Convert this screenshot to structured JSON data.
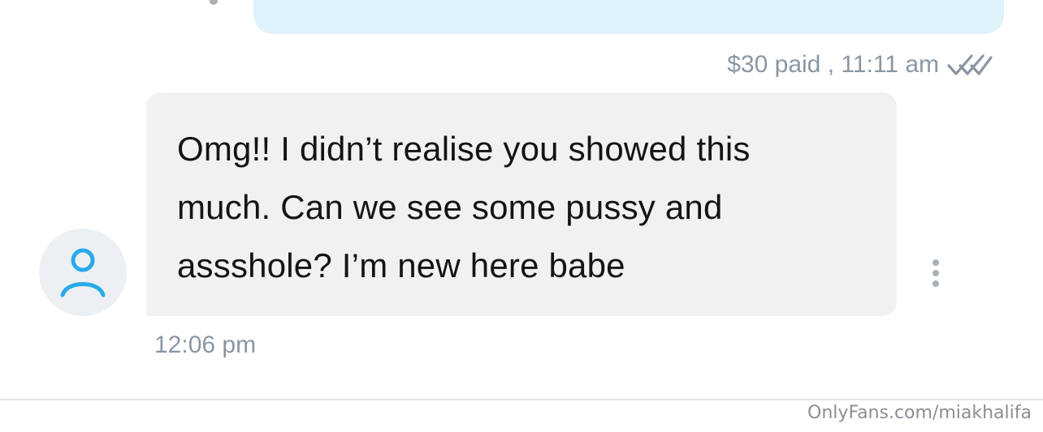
{
  "sent_message": {
    "meta_text": "$30 paid , 11:11 am",
    "status_icon": "double-check-icon"
  },
  "received_message": {
    "text": "Omg!! I didn’t realise you showed this much. Can we see some pussy and assshole? I’m new here babe",
    "time": "12:06 pm",
    "avatar_icon": "user-icon",
    "menu_icon": "more-vertical-icon"
  },
  "footer": {
    "watermark": "OnlyFans.com/miakhalifa"
  },
  "colors": {
    "sent_bubble": "#dff1fb",
    "received_bubble": "#f0f1f3",
    "avatar_icon": "#27aaea",
    "meta_text": "#8a96a3"
  }
}
